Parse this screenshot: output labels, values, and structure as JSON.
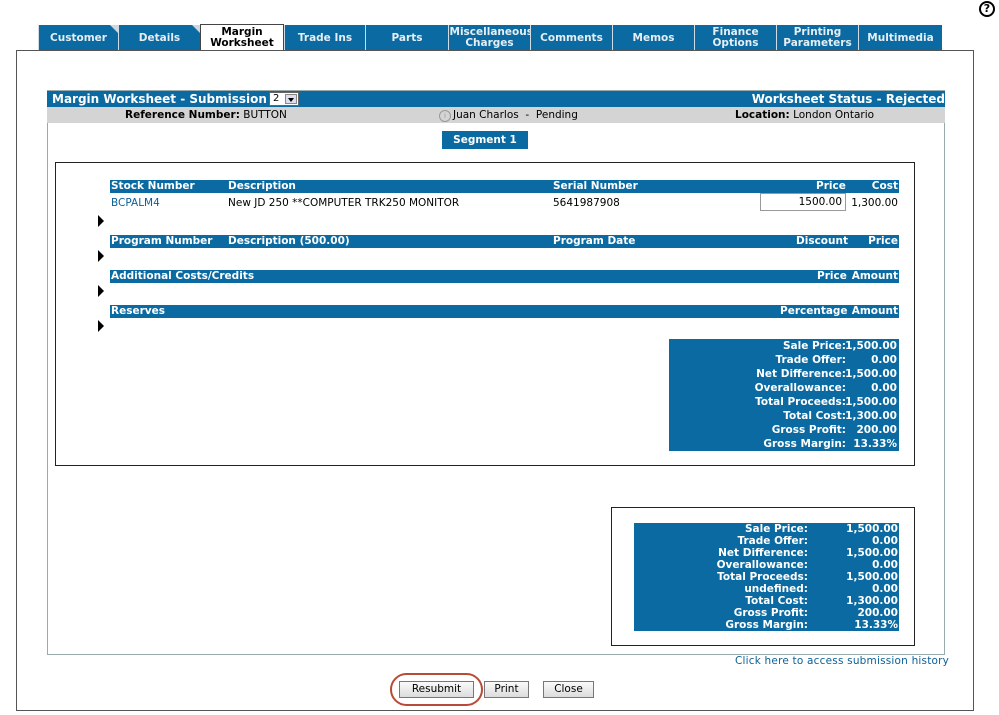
{
  "help_icon": "question-mark-icon",
  "tabs": [
    {
      "label": "Customer",
      "active": false,
      "fold": true
    },
    {
      "label": "Details",
      "active": false,
      "fold": true
    },
    {
      "label": "Margin Worksheet",
      "active": true,
      "fold": false
    },
    {
      "label": "Trade Ins",
      "active": false,
      "fold": false
    },
    {
      "label": "Parts",
      "active": false,
      "fold": false
    },
    {
      "label": "Miscellaneous Charges",
      "active": false,
      "fold": false
    },
    {
      "label": "Comments",
      "active": false,
      "fold": false
    },
    {
      "label": "Memos",
      "active": false,
      "fold": false
    },
    {
      "label": "Finance Options",
      "active": false,
      "fold": false
    },
    {
      "label": "Printing Parameters",
      "active": false,
      "fold": false
    },
    {
      "label": "Multimedia",
      "active": false,
      "fold": false
    }
  ],
  "header": {
    "title": "Margin Worksheet - Submission",
    "submission_select": "2",
    "status": "Worksheet Status - Rejected"
  },
  "info": {
    "ref_label": "Reference Number:",
    "ref_value": "BUTTON",
    "person": "Juan Charlos",
    "separator": "-",
    "person_status": "Pending",
    "loc_label": "Location:",
    "loc_value": "London Ontario"
  },
  "segment": {
    "label": "Segment 1"
  },
  "stock_table": {
    "headers": {
      "stock_number": "Stock Number",
      "description": "Description",
      "serial_number": "Serial Number",
      "price": "Price",
      "cost": "Cost"
    },
    "row": {
      "stock_number": "BCPALM4",
      "description": "New JD 250 **COMPUTER TRK250 MONITOR",
      "serial_number": "5641987908",
      "price": "1500.00",
      "cost": "1,300.00"
    }
  },
  "program_table": {
    "headers": {
      "program_number": "Program Number",
      "description": "Description (500.00)",
      "program_date": "Program Date",
      "discount": "Discount",
      "price": "Price"
    }
  },
  "additional_table": {
    "headers": {
      "title": "Additional Costs/Credits",
      "price": "Price",
      "amount": "Amount"
    }
  },
  "reserves_table": {
    "headers": {
      "title": "Reserves",
      "percentage": "Percentage",
      "amount": "Amount"
    }
  },
  "segment_summary": [
    {
      "label": "Sale Price:",
      "value": "1,500.00"
    },
    {
      "label": "Trade Offer:",
      "value": "0.00"
    },
    {
      "label": "Net Difference:",
      "value": "1,500.00"
    },
    {
      "label": "Overallowance:",
      "value": "0.00"
    },
    {
      "label": "Total Proceeds:",
      "value": "1,500.00"
    },
    {
      "label": "Total Cost:",
      "value": "1,300.00"
    },
    {
      "label": "Gross Profit:",
      "value": "200.00"
    },
    {
      "label": "Gross Margin:",
      "value": "13.33%"
    }
  ],
  "total_summary": [
    {
      "label": "Sale Price:",
      "value": "1,500.00"
    },
    {
      "label": "Trade Offer:",
      "value": "0.00"
    },
    {
      "label": "Net Difference:",
      "value": "1,500.00"
    },
    {
      "label": "Overallowance:",
      "value": "0.00"
    },
    {
      "label": "Total Proceeds:",
      "value": "1,500.00"
    },
    {
      "label": "undefined:",
      "value": "0.00"
    },
    {
      "label": "Total Cost:",
      "value": "1,300.00"
    },
    {
      "label": "Gross Profit:",
      "value": "200.00"
    },
    {
      "label": "Gross Margin:",
      "value": "13.33%"
    }
  ],
  "history_link": "Click here to access submission history",
  "buttons": {
    "resubmit": "Resubmit",
    "print": "Print",
    "close": "Close"
  },
  "colors": {
    "accent": "#0a6aa1",
    "highlight_circle": "#b94a36",
    "info_bar": "#d4d4d4"
  }
}
